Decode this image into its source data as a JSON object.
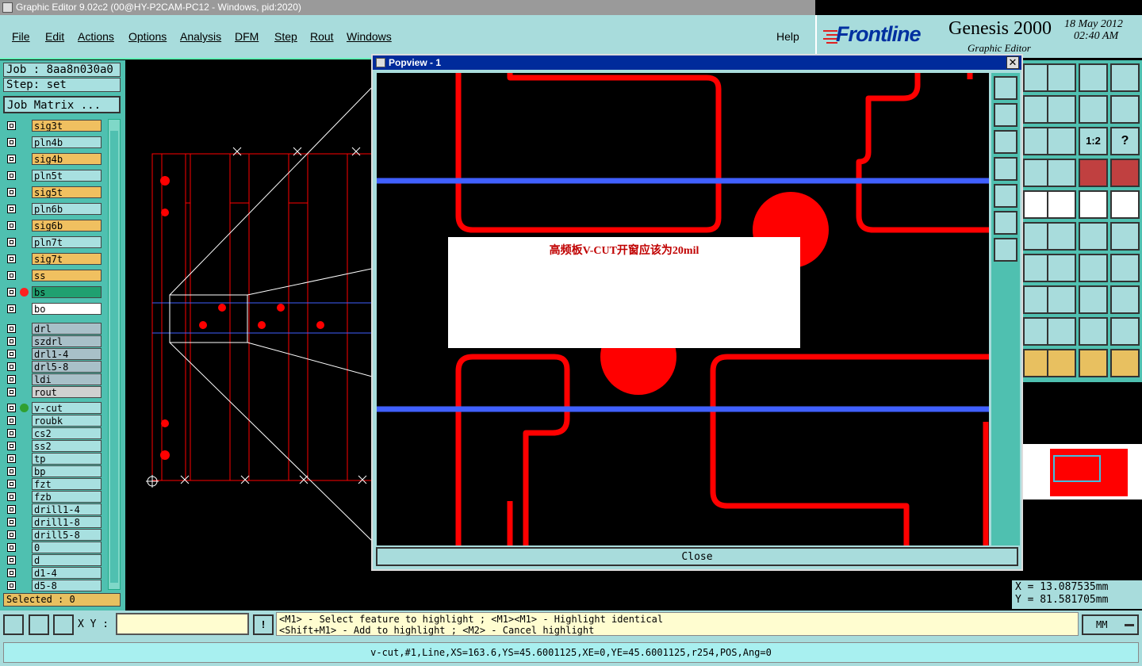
{
  "window": {
    "title": "Graphic Editor 9.02c2 (00@HY-P2CAM-PC12 - Windows, pid:2020)"
  },
  "menu": {
    "file": "File",
    "edit": "Edit",
    "actions": "Actions",
    "options": "Options",
    "analysis": "Analysis",
    "dfm": "DFM",
    "step": "Step",
    "rout": "Rout",
    "windows": "Windows",
    "help": "Help"
  },
  "brand": {
    "frontline": "Frontline",
    "genesis": "Genesis 2000",
    "date": "18 May 2012",
    "time": "02:40 AM",
    "subtitle": "Graphic Editor"
  },
  "job": {
    "job_label": "Job : 8aa8n030a0",
    "step_label": "Step: set",
    "matrix_button": "Job Matrix ..."
  },
  "layers": [
    {
      "name": "sig3t",
      "color": "#f0c060"
    },
    {
      "name": "pln4b",
      "color": "#a8e0e0"
    },
    {
      "name": "sig4b",
      "color": "#f0c060"
    },
    {
      "name": "pln5t",
      "color": "#a8e0e0"
    },
    {
      "name": "sig5t",
      "color": "#f0c060"
    },
    {
      "name": "pln6b",
      "color": "#a8e0e0"
    },
    {
      "name": "sig6b",
      "color": "#f0c060"
    },
    {
      "name": "pln7t",
      "color": "#a8e0e0"
    },
    {
      "name": "sig7t",
      "color": "#f0c060"
    },
    {
      "name": "ss",
      "color": "#f0c060"
    },
    {
      "name": "bs",
      "color": "#20a070"
    },
    {
      "name": "bo",
      "color": "#ffffff"
    },
    {
      "name": "drl",
      "color": "#a8c0c8"
    },
    {
      "name": "szdrl",
      "color": "#a8c0c8"
    },
    {
      "name": "drl1-4",
      "color": "#a8c0c8"
    },
    {
      "name": "drl5-8",
      "color": "#a8c0c8"
    },
    {
      "name": "ldi",
      "color": "#a8c0c8"
    },
    {
      "name": "rout",
      "color": "#d0d0d0"
    },
    {
      "name": "v-cut",
      "color": "#a8e0e0"
    },
    {
      "name": "roubk",
      "color": "#a8e0e0"
    },
    {
      "name": "cs2",
      "color": "#a8e0e0"
    },
    {
      "name": "ss2",
      "color": "#a8e0e0"
    },
    {
      "name": "tp",
      "color": "#a8e0e0"
    },
    {
      "name": "bp",
      "color": "#a8e0e0"
    },
    {
      "name": "fzt",
      "color": "#a8e0e0"
    },
    {
      "name": "fzb",
      "color": "#a8e0e0"
    },
    {
      "name": "drill1-4",
      "color": "#a8e0e0"
    },
    {
      "name": "drill1-8",
      "color": "#a8e0e0"
    },
    {
      "name": "drill5-8",
      "color": "#a8e0e0"
    },
    {
      "name": "0",
      "color": "#a8e0e0"
    },
    {
      "name": "d",
      "color": "#a8e0e0"
    },
    {
      "name": "d1-4",
      "color": "#a8e0e0"
    },
    {
      "name": "d5-8",
      "color": "#a8e0e0"
    }
  ],
  "selected": "Selected : 0",
  "popview": {
    "title": "Popview - 1",
    "close_button": "Close",
    "annotation": "高频板V-CUT开窗应该为20mil"
  },
  "coords": {
    "x": "X = 13.087535mm",
    "y": "Y = 81.581705mm"
  },
  "xy_label": "X Y :",
  "xy_input_value": "",
  "hint_line1": "<M1> - Select feature to highlight ; <M1><M1> - Highlight identical",
  "hint_line2": "<Shift+M1> - Add to highlight ; <M2> - Cancel highlight",
  "units": "MM",
  "status": "v-cut,#1,Line,XS=163.6,YS=45.6001125,XE=0,YE=45.6001125,r254,POS,Ang=0",
  "tool_glyphs": {
    "ratio": "1:2",
    "question": "?"
  },
  "colors": {
    "feature_red": "#ff0000",
    "vcut_blue": "#4060ff",
    "panel_teal": "#a8dcdc"
  }
}
